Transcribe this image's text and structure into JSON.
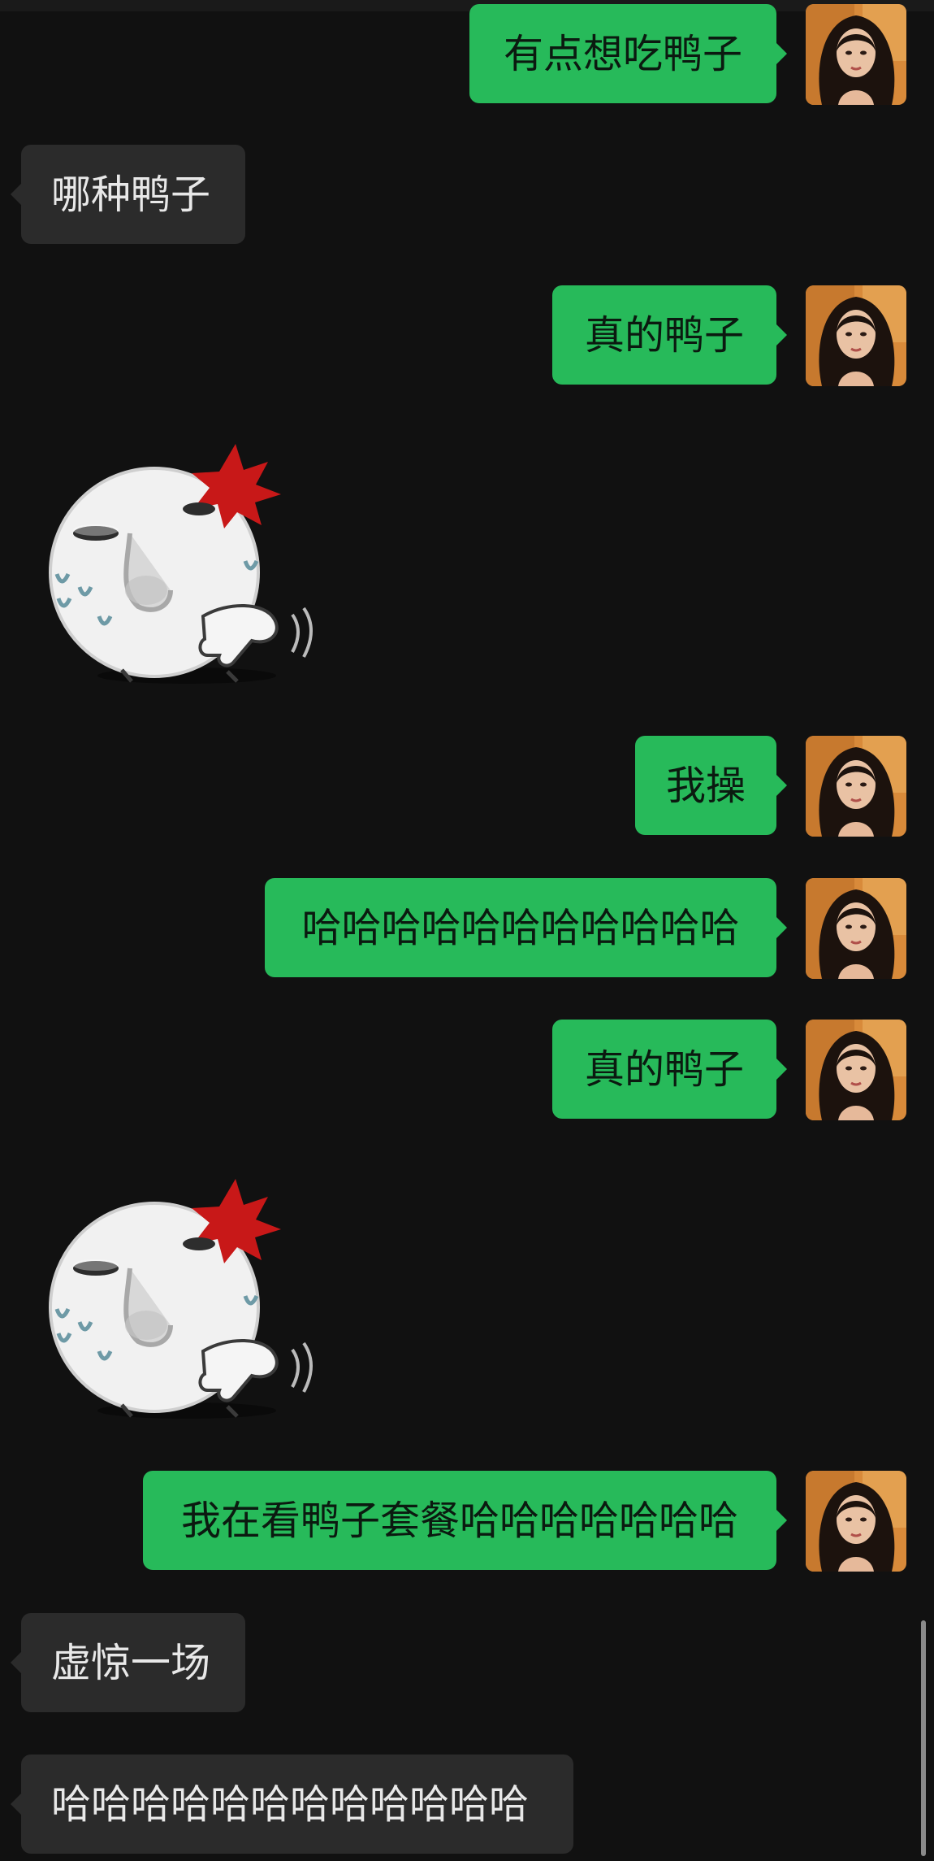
{
  "colors": {
    "background": "#111111",
    "outgoing_bubble": "#27ba5a",
    "incoming_bubble": "#2b2b2b"
  },
  "messages": [
    {
      "side": "out",
      "type": "text",
      "text": "有点想吃鸭子"
    },
    {
      "side": "in",
      "type": "text",
      "text": "哪种鸭子"
    },
    {
      "side": "out",
      "type": "text",
      "text": "真的鸭子"
    },
    {
      "side": "in",
      "type": "sticker",
      "sticker": "sweating-face-sticker"
    },
    {
      "side": "out",
      "type": "text",
      "text": "我操"
    },
    {
      "side": "out",
      "type": "text",
      "text": "哈哈哈哈哈哈哈哈哈哈哈"
    },
    {
      "side": "out",
      "type": "text",
      "text": "真的鸭子"
    },
    {
      "side": "in",
      "type": "sticker",
      "sticker": "sweating-face-sticker"
    },
    {
      "side": "out",
      "type": "text",
      "text": "我在看鸭子套餐哈哈哈哈哈哈哈"
    },
    {
      "side": "in",
      "type": "text",
      "text": "虚惊一场"
    },
    {
      "side": "in",
      "type": "text",
      "text": "哈哈哈哈哈哈哈哈哈哈哈哈"
    }
  ]
}
